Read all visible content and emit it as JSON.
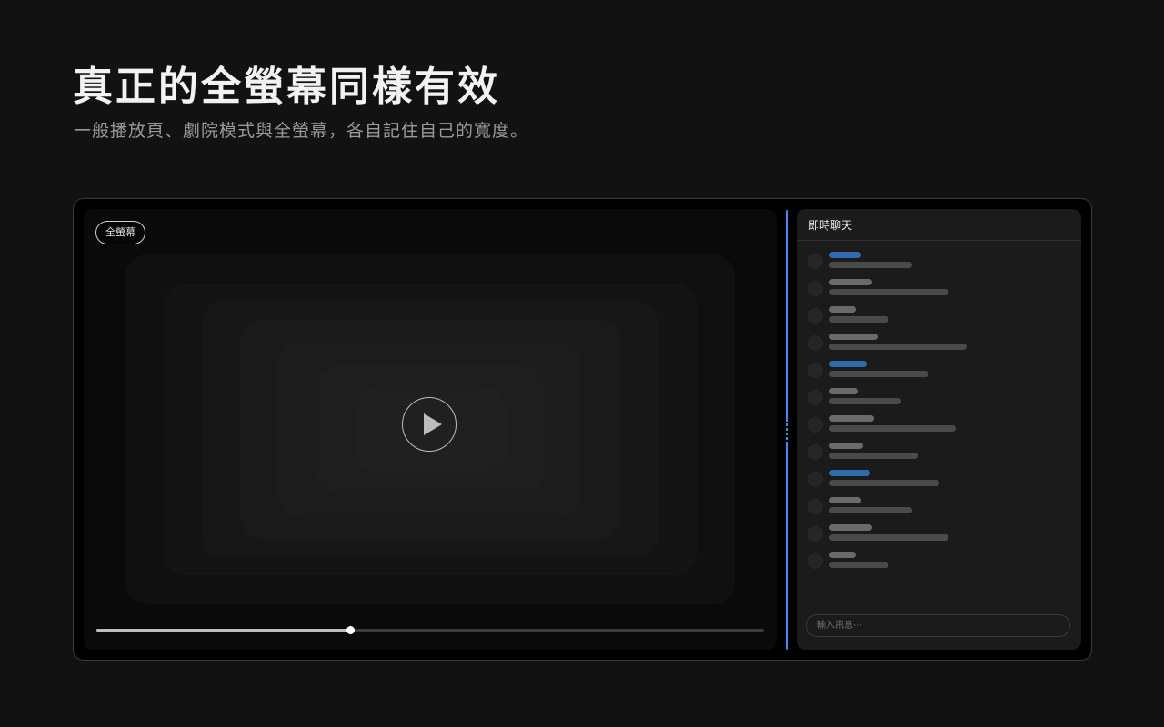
{
  "hero": {
    "title": "真正的全螢幕同樣有效",
    "subtitle": "一般播放頁、劇院模式與全螢幕，各自記住自己的寬度。"
  },
  "player": {
    "mode_label": "全螢幕",
    "progress_fraction": 0.38,
    "play_icon": "play-icon"
  },
  "chat": {
    "title": "即時聊天",
    "input_placeholder": "輸入訊息⋯",
    "messages": [
      {
        "highlight": true
      },
      {
        "highlight": false
      },
      {
        "highlight": false
      },
      {
        "highlight": false
      },
      {
        "highlight": true
      },
      {
        "highlight": false
      },
      {
        "highlight": false
      },
      {
        "highlight": false
      },
      {
        "highlight": true
      },
      {
        "highlight": false
      },
      {
        "highlight": false
      },
      {
        "highlight": false
      }
    ]
  },
  "colors": {
    "accent": "#3d8bfd",
    "name_highlight": "#2d6ab0",
    "name_normal": "#6a6a6a",
    "background": "#121212"
  }
}
